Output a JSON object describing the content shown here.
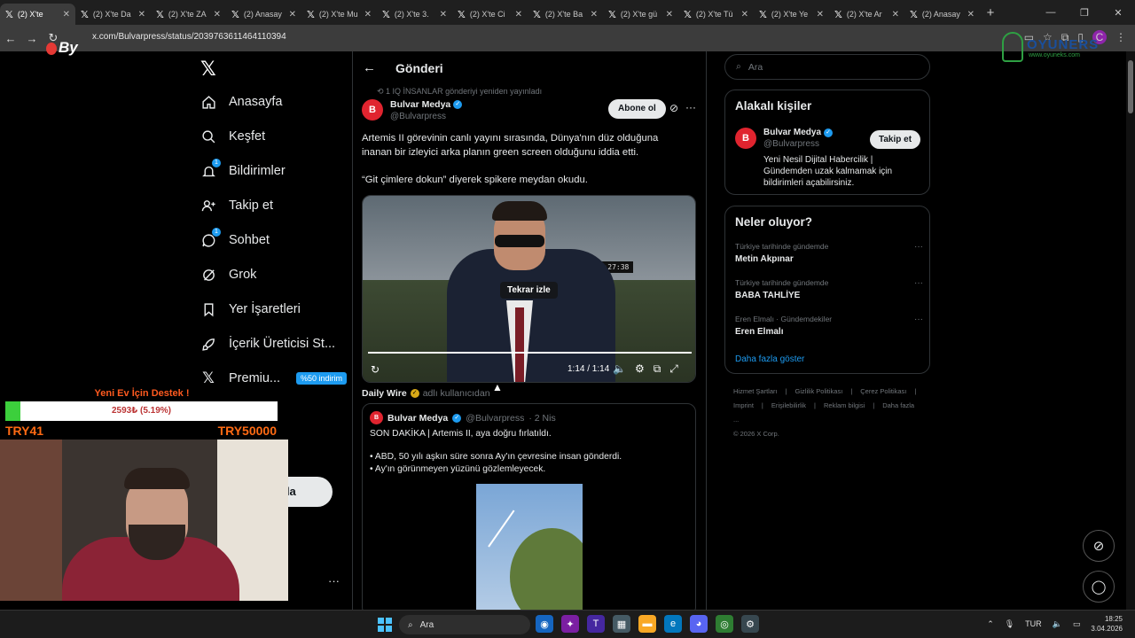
{
  "browser": {
    "tabs": [
      {
        "title": "(2) X'te"
      },
      {
        "title": "(2) X'te Da"
      },
      {
        "title": "(2) X'te ZA"
      },
      {
        "title": "(2) Anasay"
      },
      {
        "title": "(2) X'te Mu"
      },
      {
        "title": "(2) X'te 3."
      },
      {
        "title": "(2) X'te Ci"
      },
      {
        "title": "(2) X'te Ba"
      },
      {
        "title": "(2) X'te gü"
      },
      {
        "title": "(2) X'te Tü"
      },
      {
        "title": "(2) X'te Ye"
      },
      {
        "title": "(2) X'te Ar"
      },
      {
        "title": "(2) Anasay"
      }
    ],
    "url": "x.com/Bulvarpress/status/2039763611464110394",
    "profile_letter": "C"
  },
  "nav": {
    "items": [
      {
        "label": "Anasayfa",
        "icon": "home-icon"
      },
      {
        "label": "Keşfet",
        "icon": "search-icon"
      },
      {
        "label": "Bildirimler",
        "icon": "bell-icon",
        "badge": "1"
      },
      {
        "label": "Takip et",
        "icon": "add-person-icon"
      },
      {
        "label": "Sohbet",
        "icon": "chat-icon",
        "badge": "1"
      },
      {
        "label": "Grok",
        "icon": "grok-icon"
      },
      {
        "label": "Yer İşaretleri",
        "icon": "bookmark-icon"
      },
      {
        "label": "İçerik Üreticisi St...",
        "icon": "rocket-icon"
      },
      {
        "label": "Premiu...",
        "icon": "x-premium-icon",
        "promo": "%50 indirim"
      }
    ],
    "post_label": "nla",
    "more": "···"
  },
  "main": {
    "title": "Gönderi",
    "repost_line": "1 IQ İNSANLAR gönderiyi yeniden yayınladı",
    "tweet": {
      "author": "Bulvar Medya",
      "handle": "@Bulvarpress",
      "follow_label": "Abone ol",
      "text1": "Artemis II görevinin canlı yayını sırasında, Dünya'nın düz olduğuna inanan bir izleyici arka planın green screen olduğunu iddia etti.",
      "text2": "“Git çimlere dokun” diyerek spikere meydan okudu.",
      "video": {
        "replay_label": "Tekrar izle",
        "time": "1:14 / 1:14",
        "sign_text": "-00:27:38",
        "progress_fraction": 1.0
      }
    },
    "quote_source": {
      "name": "Daily Wire",
      "suffix": "adlı kullanıcıdan"
    },
    "quote": {
      "author": "Bulvar Medya",
      "handle": "@Bulvarpress",
      "date": "· 2 Nis",
      "text1": "SON DAKİKA | Artemis II, aya doğru fırlatıldı.",
      "text2": "• ABD, 50 yılı aşkın süre sonra Ay'ın çevresine insan gönderdi.",
      "text3": "• Ay'ın görünmeyen yüzünü gözlemleyecek."
    }
  },
  "right": {
    "search_placeholder": "Ara",
    "related": {
      "title": "Alakalı kişiler",
      "name": "Bulvar Medya",
      "handle": "@Bulvarpress",
      "follow_label": "Takip et",
      "bio": "Yeni Nesil Dijital Habercilik | Gündemden uzak kalmamak için bildirimleri açabilirsiniz."
    },
    "trends": {
      "title": "Neler oluyor?",
      "items": [
        {
          "context": "Türkiye tarihinde gündemde",
          "name": "Metin Akpınar"
        },
        {
          "context": "Türkiye tarihinde gündemde",
          "name": "BABA TAHLİYE"
        },
        {
          "context": "Eren Elmalı · Gündemdekiler",
          "name": "Eren Elmalı"
        }
      ],
      "show_more": "Daha fazla göster"
    },
    "footer": [
      "Hizmet Şartları",
      "|",
      "Gizlilik Politikası",
      "|",
      "Çerez Politikası",
      "|",
      "Imprint",
      "|",
      "Erişilebilirlik",
      "|",
      "Reklam bilgisi",
      "|",
      "Daha fazla ...",
      "© 2026 X Corp."
    ]
  },
  "overlay": {
    "donation_title": "Yeni Ev İçin Destek !",
    "donation_value": "2593₺ (5.19%)",
    "donation_fraction": 0.0519,
    "donation_min": "TRY41",
    "donation_max": "TRY50000",
    "logo_text": "By",
    "brand_text": "OYUNERS",
    "brand_sub": "www.oyuneks.com"
  },
  "taskbar": {
    "search_label": "Ara",
    "lang": "TUR",
    "time": "18:25",
    "date": "3.04.2026"
  },
  "colors": {
    "accent": "#1d9bf0",
    "brand_red": "#e0242f",
    "donation_orange": "#ff6a13"
  }
}
